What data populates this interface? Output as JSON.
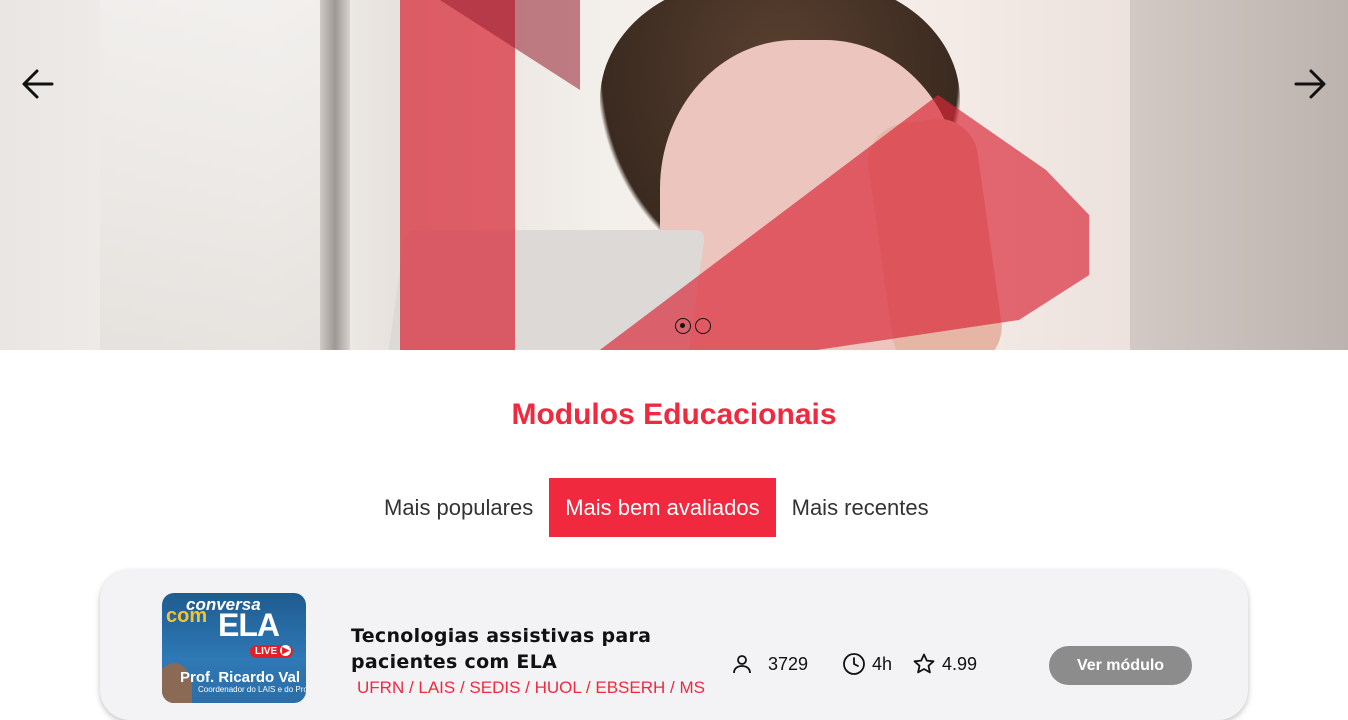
{
  "carousel": {
    "slide_count": 2,
    "active_slide": 1,
    "prev_icon": "arrow-left-icon",
    "next_icon": "arrow-right-icon",
    "accent_color": "#d82838"
  },
  "section": {
    "title": "Modulos Educacionais"
  },
  "tabs": [
    {
      "label": "Mais populares",
      "active": false
    },
    {
      "label": "Mais bem avaliados",
      "active": true
    },
    {
      "label": "Mais recentes",
      "active": false
    }
  ],
  "modules": [
    {
      "thumbnail": {
        "line1": "conversa",
        "line2": "com",
        "line3": "ELA",
        "live_badge": "LIVE",
        "presenter": "Prof. Ricardo Val",
        "caption": "Coordenador do LAIS e do Proje"
      },
      "title": "Tecnologias assistivas para pacientes com ELA",
      "partners": "UFRN / LAIS / SEDIS / HUOL / EBSERH / MS",
      "enrolled": "3729",
      "duration": "4h",
      "rating": "4.99",
      "button_label": "Ver módulo"
    }
  ],
  "colors": {
    "brand_red": "#f0293f",
    "button_gray": "#8c8c8c",
    "card_bg": "#f3f3f5"
  }
}
